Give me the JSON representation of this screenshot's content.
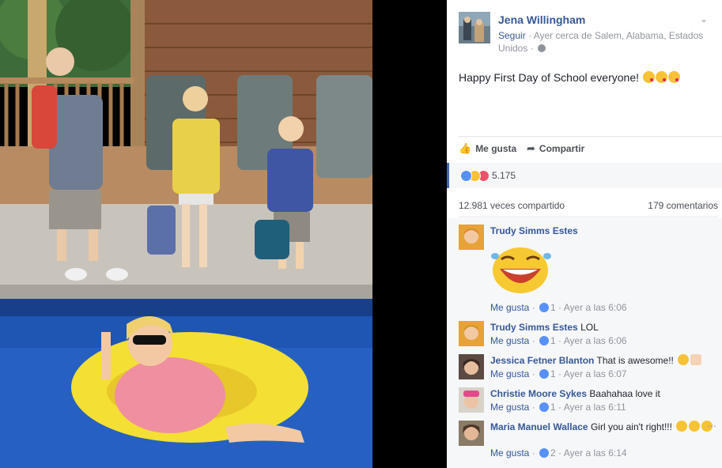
{
  "post": {
    "author": "Jena Willingham",
    "follow_label": "Seguir",
    "meta_text": "Ayer cerca de Salem, Alabama, Estados Unidos",
    "meta_sep": " · ",
    "text": "Happy First Day of School everyone! ",
    "text_emojis": [
      "kissing-heart-emoji",
      "kissing-heart-emoji",
      "kissing-heart-emoji"
    ],
    "chevron_icon": "chevron-down-icon"
  },
  "actions": {
    "like_label": "Me gusta",
    "like_icon": "thumbs-up-icon",
    "share_label": "Compartir",
    "share_icon": "share-arrow-icon"
  },
  "reactions": {
    "icons": [
      "like-reaction-icon",
      "haha-reaction-icon",
      "love-reaction-icon"
    ],
    "count": "5.175",
    "colors": {
      "like": "#5890ff",
      "haha": "#f7c236",
      "love": "#f25268"
    }
  },
  "stats": {
    "shares": "12.981 veces compartido",
    "comments": "179 comentarios"
  },
  "comments": [
    {
      "name": "Trudy Simms Estes",
      "text": "",
      "sticker": "laughing-face-sticker",
      "like_label": "Me gusta",
      "reactions": "1",
      "time": "Ayer a las 6:06"
    },
    {
      "name": "Trudy Simms Estes",
      "text": "LOL",
      "like_label": "Me gusta",
      "reactions": "1",
      "time": "Ayer a las 6:06"
    },
    {
      "name": "Jessica Fetner Blanton",
      "text": "That is awesome!! ",
      "like_label": "Me gusta",
      "reactions": "1",
      "time": "Ayer a las 6:07",
      "emojis": [
        "rolling-laughing-emoji",
        "clapping-hands-emoji"
      ]
    },
    {
      "name": "Christie Moore Sykes",
      "text": "Baahahaa love it",
      "like_label": "Me gusta",
      "reactions": "1",
      "time": "Ayer a las 6:11"
    },
    {
      "name": "Maria Manuel Wallace",
      "text": "Girl you ain't right!!! ",
      "like_label": "Me gusta",
      "reactions": "2",
      "time": "Ayer a las 6:14",
      "emojis": [
        "grinning-sweat-emoji",
        "grinning-sweat-emoji",
        "grinning-sweat-emoji"
      ]
    }
  ],
  "separator": " · ",
  "colors": {
    "link": "#365899",
    "muted": "#90949c",
    "panel_bg": "#f6f7f9",
    "accent": "#4267b2"
  }
}
